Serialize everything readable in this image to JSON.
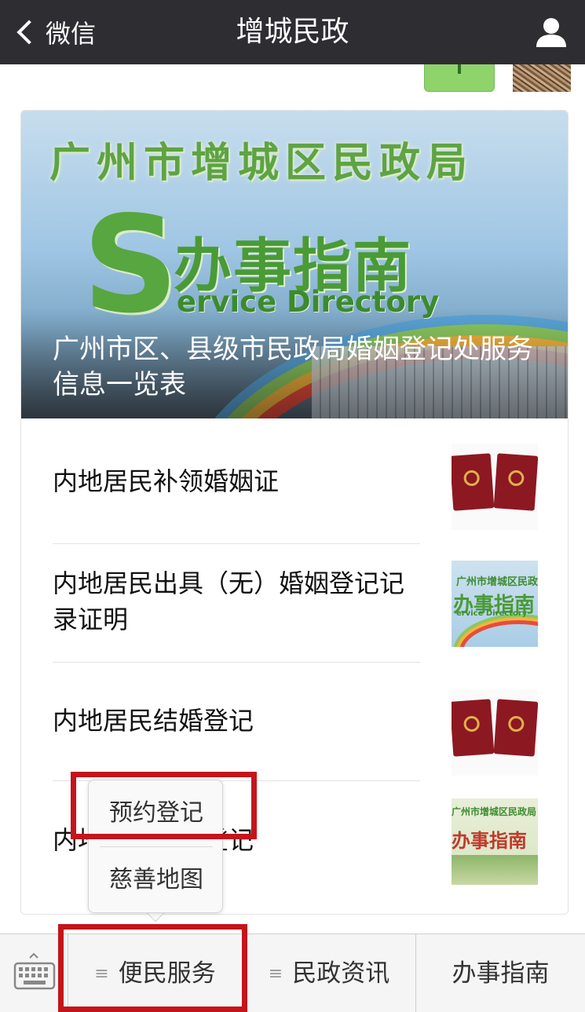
{
  "navbar": {
    "back_label": "微信",
    "title": "增城民政"
  },
  "article": {
    "cover": {
      "org_name": "广州市增城区民政局",
      "banner_letter": "S",
      "banner_cn": "办事指南",
      "banner_en": "ervice Directory",
      "title": "广州市区、县级市民政局婚姻登记处服务信息一览表"
    },
    "items": [
      {
        "title": "内地居民补领婚姻证"
      },
      {
        "title": "内地居民出具（无）婚姻登记记录证明"
      },
      {
        "title": "内地居民结婚登记"
      },
      {
        "title": "内地居民离婚登记"
      }
    ],
    "thumb_texts": {
      "sd_org": "广州市增城区民政局",
      "sd_cn": "办事指南",
      "sd_en": "ervice Directory"
    }
  },
  "popup_menu": {
    "items": [
      {
        "label": "预约登记"
      },
      {
        "label": "慈善地图"
      }
    ]
  },
  "bottom_menu": {
    "lines_glyph": "≡",
    "items": [
      {
        "label": "便民服务"
      },
      {
        "label": "民政资讯"
      },
      {
        "label": "办事指南"
      }
    ]
  },
  "colors": {
    "navbar": "#2e2e32",
    "highlight": "#c4151c",
    "banner_green": "#57a640"
  }
}
